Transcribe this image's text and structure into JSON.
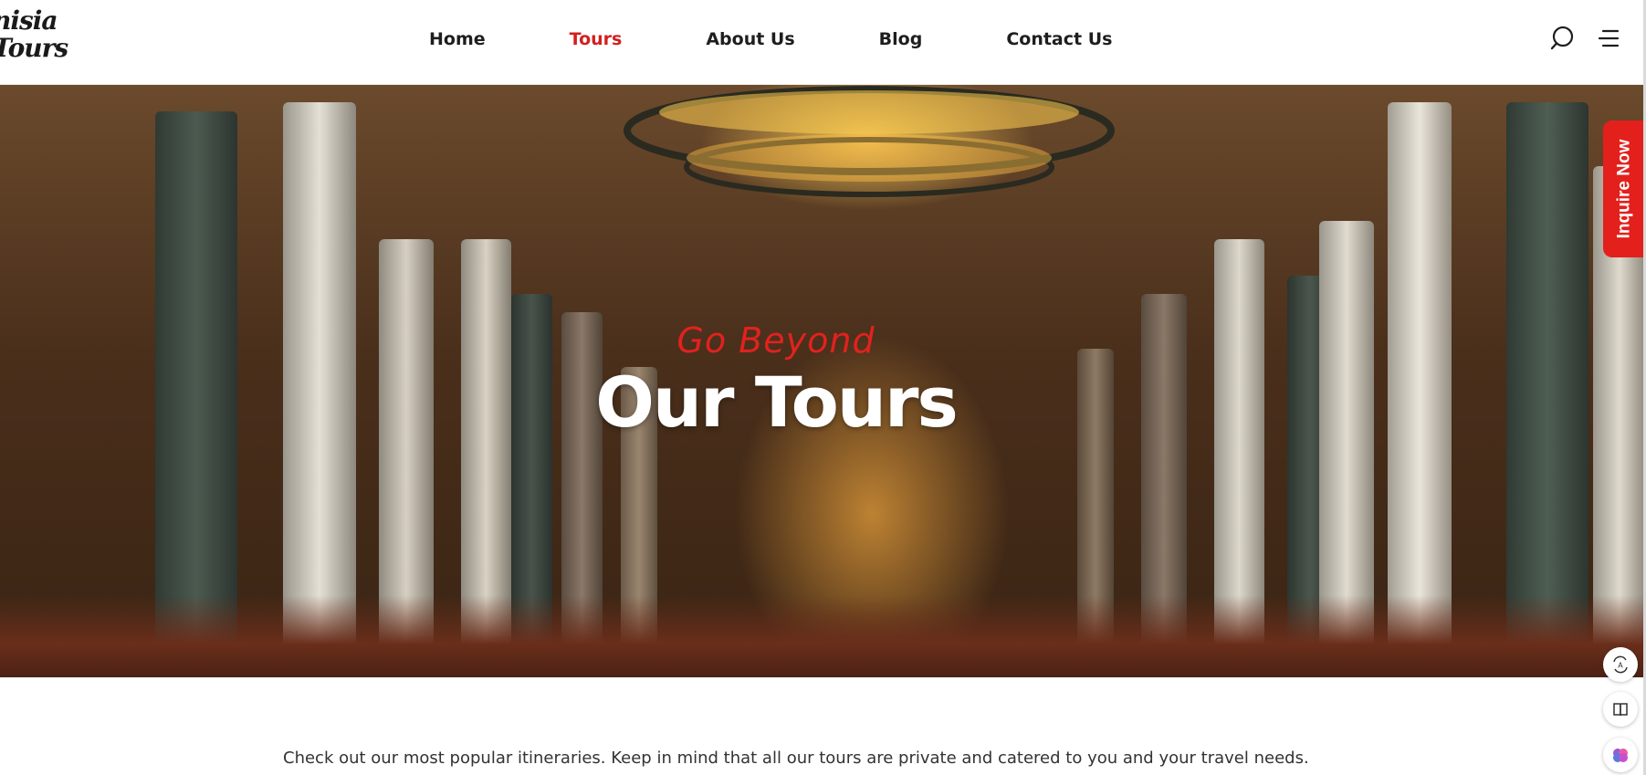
{
  "brand": {
    "logo_line1": "nisia",
    "logo_line2": "Tours"
  },
  "nav": {
    "items": [
      {
        "label": "Home"
      },
      {
        "label": "Tours",
        "active": true
      },
      {
        "label": "About Us"
      },
      {
        "label": "Blog"
      },
      {
        "label": "Contact Us"
      }
    ]
  },
  "header_icons": {
    "search": "search-icon",
    "menu": "menu-icon"
  },
  "hero": {
    "eyebrow": "Go Beyond",
    "title": "Our Tours"
  },
  "inquire": {
    "label": "Inquire Now"
  },
  "floating": {
    "icons": [
      "translate-icon",
      "book-icon",
      "brain-icon"
    ]
  },
  "intro": {
    "text": "Check out our most popular itineraries. Keep in mind that all our tours are private and catered to you and your travel needs."
  },
  "colors": {
    "accent": "#e3201c",
    "nav_active": "#d21f1f",
    "text": "#1e1e1e"
  }
}
